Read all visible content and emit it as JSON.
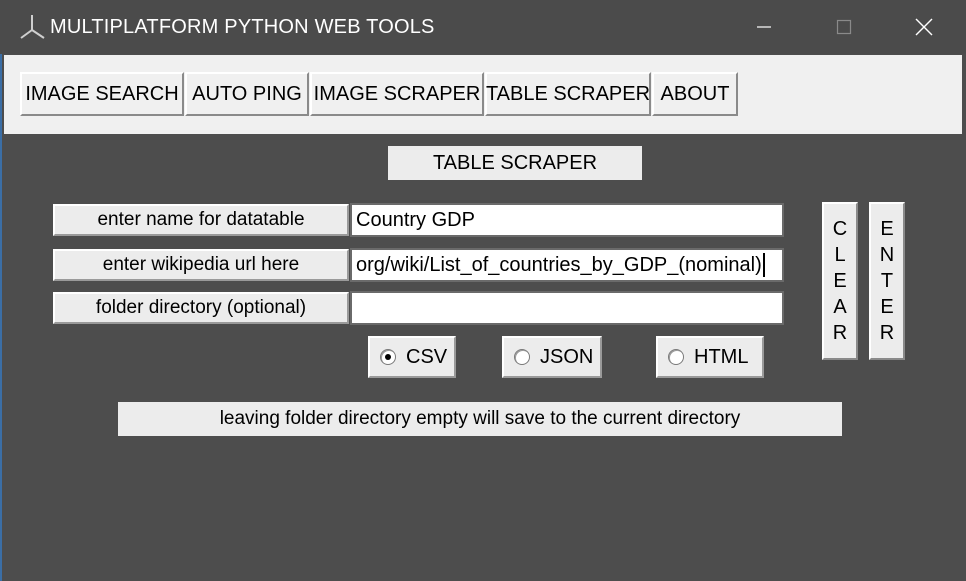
{
  "window": {
    "title": "MULTIPLATFORM PYTHON WEB TOOLS",
    "controls": {
      "minimize_icon": "minimize-icon",
      "maximize_icon": "maximize-icon",
      "close_icon": "close-icon"
    }
  },
  "tabs": [
    {
      "label": "IMAGE SEARCH"
    },
    {
      "label": "AUTO PING"
    },
    {
      "label": "IMAGE SCRAPER"
    },
    {
      "label": "TABLE SCRAPER"
    },
    {
      "label": "ABOUT"
    }
  ],
  "page": {
    "heading": "TABLE SCRAPER",
    "fields": [
      {
        "label": "enter name for datatable",
        "value": "Country GDP"
      },
      {
        "label": "enter wikipedia url here",
        "value": "org/wiki/List_of_countries_by_GDP_(nominal)"
      },
      {
        "label": "folder directory (optional)",
        "value": ""
      }
    ],
    "formats": [
      {
        "label": "CSV",
        "checked": true
      },
      {
        "label": "JSON",
        "checked": false
      },
      {
        "label": "HTML",
        "checked": false
      }
    ],
    "clear_button": {
      "letters": [
        "C",
        "L",
        "E",
        "A",
        "R"
      ]
    },
    "enter_button": {
      "letters": [
        "E",
        "N",
        "T",
        "E",
        "R"
      ]
    },
    "info": "leaving folder directory empty will save to the current directory"
  },
  "colors": {
    "titlebar": "#4b4b4b",
    "content_bg": "#4d4d4d",
    "widget_bg": "#ececec"
  }
}
